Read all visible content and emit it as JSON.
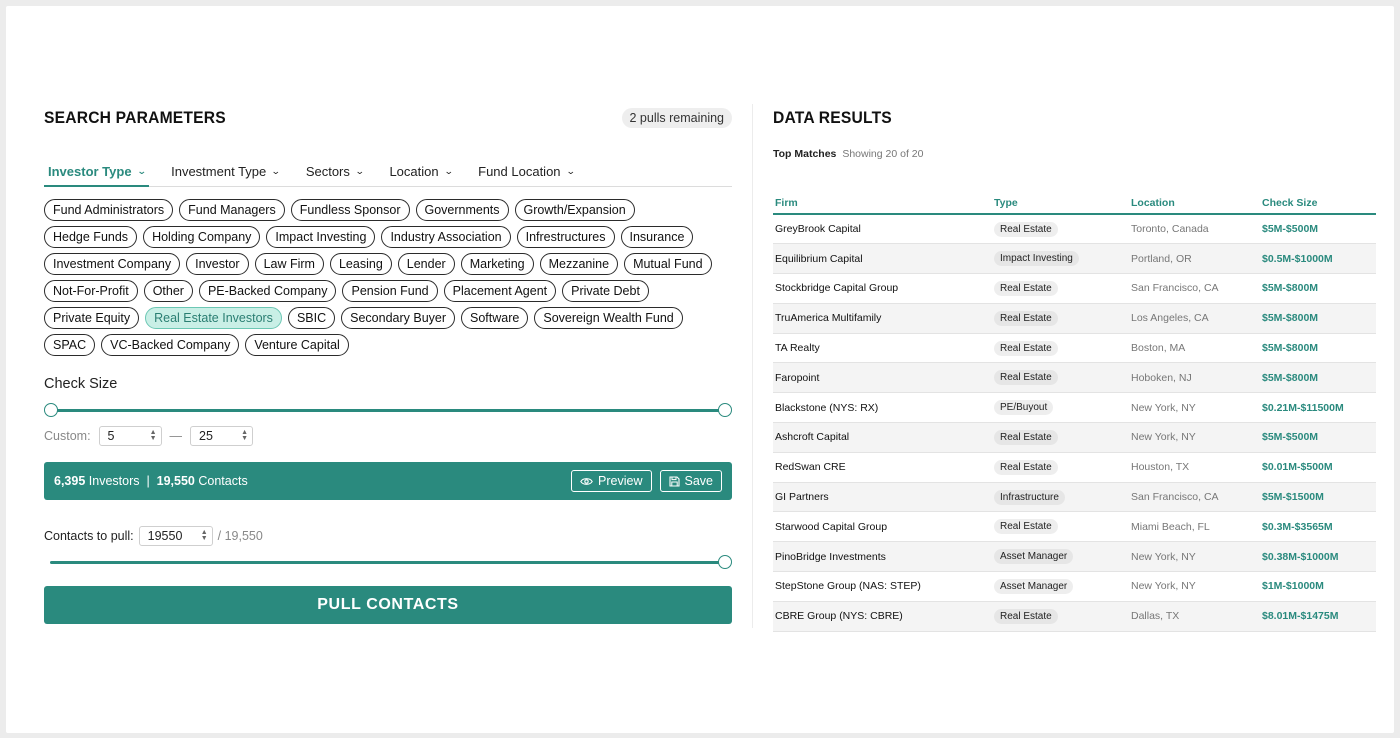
{
  "left": {
    "title": "SEARCH PARAMETERS",
    "pulls_remaining": "2 pulls remaining",
    "tabs": [
      {
        "label": "Investor Type",
        "active": true
      },
      {
        "label": "Investment Type",
        "active": false
      },
      {
        "label": "Sectors",
        "active": false
      },
      {
        "label": "Location",
        "active": false
      },
      {
        "label": "Fund Location",
        "active": false
      }
    ],
    "chips": [
      {
        "label": "Fund Administrators",
        "selected": false
      },
      {
        "label": "Fund Managers",
        "selected": false
      },
      {
        "label": "Fundless Sponsor",
        "selected": false
      },
      {
        "label": "Governments",
        "selected": false
      },
      {
        "label": "Growth/Expansion",
        "selected": false
      },
      {
        "label": "Hedge Funds",
        "selected": false
      },
      {
        "label": "Holding Company",
        "selected": false
      },
      {
        "label": "Impact Investing",
        "selected": false
      },
      {
        "label": "Industry Association",
        "selected": false
      },
      {
        "label": "Infrestructures",
        "selected": false
      },
      {
        "label": "Insurance",
        "selected": false
      },
      {
        "label": "Investment Company",
        "selected": false
      },
      {
        "label": "Investor",
        "selected": false
      },
      {
        "label": "Law Firm",
        "selected": false
      },
      {
        "label": "Leasing",
        "selected": false
      },
      {
        "label": "Lender",
        "selected": false
      },
      {
        "label": "Marketing",
        "selected": false
      },
      {
        "label": "Mezzanine",
        "selected": false
      },
      {
        "label": "Mutual Fund",
        "selected": false
      },
      {
        "label": "Not-For-Profit",
        "selected": false
      },
      {
        "label": "Other",
        "selected": false
      },
      {
        "label": "PE-Backed Company",
        "selected": false
      },
      {
        "label": "Pension Fund",
        "selected": false
      },
      {
        "label": "Placement Agent",
        "selected": false
      },
      {
        "label": "Private Debt",
        "selected": false
      },
      {
        "label": "Private Equity",
        "selected": false
      },
      {
        "label": "Real Estate Investors",
        "selected": true
      },
      {
        "label": "SBIC",
        "selected": false
      },
      {
        "label": "Secondary Buyer",
        "selected": false
      },
      {
        "label": "Software",
        "selected": false
      },
      {
        "label": "Sovereign Wealth Fund",
        "selected": false
      },
      {
        "label": "SPAC",
        "selected": false
      },
      {
        "label": "VC-Backed Company",
        "selected": false
      },
      {
        "label": "Venture Capital",
        "selected": false
      }
    ],
    "check_size": {
      "label": "Check Size",
      "custom_label": "Custom:",
      "min_value": "5",
      "separator": "—",
      "max_value": "25",
      "slider_min_fraction": 0,
      "slider_max_fraction": 1
    },
    "summary": {
      "investors_count": "6,395",
      "investors_label": "Investors",
      "separator": "|",
      "contacts_count": "19,550",
      "contacts_label": "Contacts",
      "preview_label": "Preview",
      "save_label": "Save"
    },
    "contacts_pull": {
      "label": "Contacts to pull:",
      "value": "19550",
      "total": "/ 19,550",
      "slider_fraction": 1
    },
    "pull_button": "PULL CONTACTS"
  },
  "right": {
    "title": "DATA RESULTS",
    "top_matches_label": "Top Matches",
    "showing_text": "Showing 20 of 20",
    "columns": [
      "Firm",
      "Type",
      "Location",
      "Check Size"
    ],
    "rows": [
      {
        "firm": "GreyBrook Capital",
        "type": "Real Estate",
        "location": "Toronto, Canada",
        "size": "$5M-$500M"
      },
      {
        "firm": "Equilibrium Capital",
        "type": "Impact Investing",
        "location": "Portland, OR",
        "size": "$0.5M-$1000M"
      },
      {
        "firm": "Stockbridge Capital Group",
        "type": "Real Estate",
        "location": "San Francisco, CA",
        "size": "$5M-$800M"
      },
      {
        "firm": "TruAmerica Multifamily",
        "type": "Real Estate",
        "location": "Los Angeles, CA",
        "size": "$5M-$800M"
      },
      {
        "firm": "TA Realty",
        "type": "Real Estate",
        "location": "Boston, MA",
        "size": "$5M-$800M"
      },
      {
        "firm": "Faropoint",
        "type": "Real Estate",
        "location": "Hoboken, NJ",
        "size": "$5M-$800M"
      },
      {
        "firm": "Blackstone (NYS: RX)",
        "type": "PE/Buyout",
        "location": "New York, NY",
        "size": "$0.21M-$11500M"
      },
      {
        "firm": "Ashcroft Capital",
        "type": "Real Estate",
        "location": "New York, NY",
        "size": "$5M-$500M"
      },
      {
        "firm": "RedSwan CRE",
        "type": "Real Estate",
        "location": "Houston, TX",
        "size": "$0.01M-$500M"
      },
      {
        "firm": "GI Partners",
        "type": "Infrastructure",
        "location": "San Francisco, CA",
        "size": "$5M-$1500M"
      },
      {
        "firm": "Starwood Capital Group",
        "type": "Real Estate",
        "location": "Miami Beach, FL",
        "size": "$0.3M-$3565M"
      },
      {
        "firm": "PinoBridge Investments",
        "type": "Asset Manager",
        "location": "New York, NY",
        "size": "$0.38M-$1000M"
      },
      {
        "firm": "StepStone Group (NAS: STEP)",
        "type": "Asset Manager",
        "location": "New York, NY",
        "size": "$1M-$1000M"
      },
      {
        "firm": "CBRE Group (NYS: CBRE)",
        "type": "Real Estate",
        "location": "Dallas, TX",
        "size": "$8.01M-$1475M"
      }
    ]
  },
  "icons": {
    "chevron": "chevron-down-icon",
    "preview": "eye-icon",
    "save": "floppy-disk-icon",
    "spinner": "spinner-arrows-icon"
  },
  "colors": {
    "accent": "#2a8a7e",
    "selected_chip_bg": "#c9efe6",
    "background": "#ececec"
  }
}
